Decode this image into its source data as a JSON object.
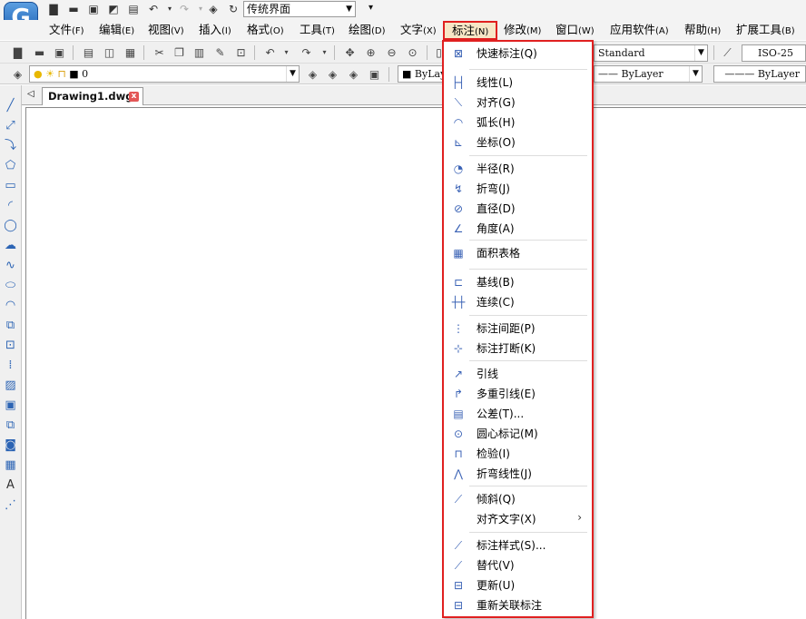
{
  "quick_access": {
    "logo_letter": "G",
    "workspace_value": "传统界面"
  },
  "menubar": [
    {
      "label": "文件",
      "key": "(F)"
    },
    {
      "label": "编辑",
      "key": "(E)"
    },
    {
      "label": "视图",
      "key": "(V)"
    },
    {
      "label": "插入",
      "key": "(I)"
    },
    {
      "label": "格式",
      "key": "(O)"
    },
    {
      "label": "工具",
      "key": "(T)"
    },
    {
      "label": "绘图",
      "key": "(D)"
    },
    {
      "label": "文字",
      "key": "(X)"
    },
    {
      "label": "标注",
      "key": "(N)"
    },
    {
      "label": "修改",
      "key": "(M)"
    },
    {
      "label": "窗口",
      "key": "(W)"
    },
    {
      "label": "应用软件",
      "key": "(A)"
    },
    {
      "label": "帮助",
      "key": "(H)"
    },
    {
      "label": "扩展工具",
      "key": "(B)"
    }
  ],
  "toolbar": {
    "text_style": "Standard",
    "dim_style": "ISO-25",
    "layer_value": "0",
    "color_value": "ByLayer",
    "linetype_value": "ByLayer",
    "lineweight_value": "ByLayer"
  },
  "tab": {
    "label": "Drawing1.dwg",
    "close": "x"
  },
  "dim_menu": {
    "groups": [
      [
        {
          "label": "快速标注(Q)",
          "icon": "quick-dim-icon"
        }
      ],
      [
        {
          "label": "线性(L)",
          "icon": "linear-dim-icon"
        },
        {
          "label": "对齐(G)",
          "icon": "aligned-dim-icon"
        },
        {
          "label": "弧长(H)",
          "icon": "arc-length-icon"
        },
        {
          "label": "坐标(O)",
          "icon": "ordinate-icon"
        }
      ],
      [
        {
          "label": "半径(R)",
          "icon": "radius-icon"
        },
        {
          "label": "折弯(J)",
          "icon": "jogged-icon"
        },
        {
          "label": "直径(D)",
          "icon": "diameter-icon"
        },
        {
          "label": "角度(A)",
          "icon": "angle-icon"
        }
      ],
      [
        {
          "label": "面积表格",
          "icon": "area-table-icon"
        }
      ],
      [
        {
          "label": "基线(B)",
          "icon": "baseline-icon"
        },
        {
          "label": "连续(C)",
          "icon": "continue-icon"
        }
      ],
      [
        {
          "label": "标注间距(P)",
          "icon": "dim-space-icon"
        },
        {
          "label": "标注打断(K)",
          "icon": "dim-break-icon"
        }
      ],
      [
        {
          "label": "引线",
          "icon": "leader-icon"
        },
        {
          "label": "多重引线(E)",
          "icon": "multileader-icon"
        },
        {
          "label": "公差(T)...",
          "icon": "tolerance-icon"
        },
        {
          "label": "圆心标记(M)",
          "icon": "center-mark-icon"
        },
        {
          "label": "检验(I)",
          "icon": "inspect-icon"
        },
        {
          "label": "折弯线性(J)",
          "icon": "jogged-linear-icon"
        }
      ],
      [
        {
          "label": "倾斜(Q)",
          "icon": "oblique-icon"
        },
        {
          "label": "对齐文字(X)",
          "icon": "",
          "submenu": true
        }
      ],
      [
        {
          "label": "标注样式(S)...",
          "icon": "dim-style-icon"
        },
        {
          "label": "替代(V)",
          "icon": "override-icon"
        },
        {
          "label": "更新(U)",
          "icon": "update-icon"
        },
        {
          "label": "重新关联标注",
          "icon": "reassociate-icon"
        }
      ]
    ]
  }
}
